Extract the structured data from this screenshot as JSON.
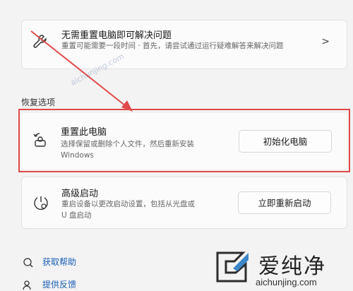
{
  "top_card": {
    "title": "无需重置电脑即可解决问题",
    "desc": "重置可能需要一段时间 · 首先，请尝试通过运行疑难解答来解决问题",
    "chevron": ">"
  },
  "section_title": "恢复选项",
  "reset_card": {
    "title": "重置此电脑",
    "desc_line1": "选择保留或删除个人文件，然后重新安装",
    "desc_line2": "Windows",
    "button_label": "初始化电脑"
  },
  "advanced_card": {
    "title": "高级启动",
    "desc_line1": "重启设备以更改启动设置，包括从光盘或",
    "desc_line2": "U 盘启动",
    "button_label": "立即重新启动"
  },
  "links": {
    "help": "获取帮助",
    "feedback": "提供反馈"
  },
  "watermark": {
    "brand": "爱纯净",
    "url": "aichunjing.com"
  },
  "colors": {
    "highlight": "#e04a4a",
    "link": "#1b5fb3"
  },
  "icons": [
    "wrench-icon",
    "reset-pc-icon",
    "advanced-startup-icon",
    "help-icon",
    "feedback-icon",
    "chevron-right-icon"
  ]
}
